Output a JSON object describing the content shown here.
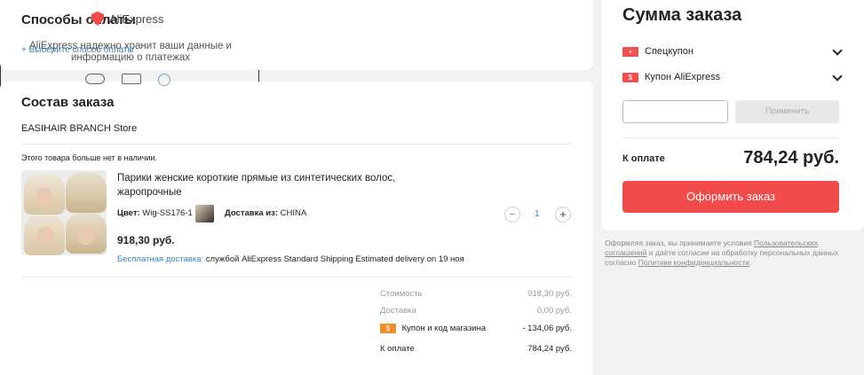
{
  "payment": {
    "title": "Способы оплаты",
    "choose_link": "+ Выберите способ оплаты"
  },
  "order": {
    "title": "Состав заказа",
    "store": "EASIHAIR BRANCH Store",
    "unavailable_notice": "Этого товара больше нет в наличии.",
    "item": {
      "name": "Парики женские короткие прямые из синтетических волос, жаропрочные",
      "color_label": "Цвет:",
      "color_value": "Wig-SS176-1",
      "delivery_from_label": "Доставка из:",
      "delivery_from_value": "CHINA",
      "quantity": "1",
      "price": "918,30 руб.",
      "shipping_label": "Бесплатная доставка:",
      "shipping_text": "службой AliExpress Standard Shipping  Estimated delivery on 19 ноя"
    },
    "summary": {
      "cost_label": "Стоимость",
      "cost_value": "918,30 руб.",
      "delivery_label": "Доставка",
      "delivery_value": "0,00 руб.",
      "coupon_icon": "$",
      "coupon_label": "Купон и код магазина",
      "coupon_value": "- 134,06 руб.",
      "total_label": "К оплате",
      "total_value": "784,24 руб."
    }
  },
  "sum": {
    "title": "Сумма заказа",
    "special_coupon_icon": "+",
    "special_coupon": "Спецкупон",
    "ae_coupon_icon": "$",
    "ae_coupon": "Купон AliExpress",
    "code_input_value": "",
    "apply_label": "Применить",
    "pay_label": "К оплате",
    "pay_total": "784,24 руб.",
    "checkout_label": "Оформить заказ"
  },
  "terms": {
    "text_1": "Оформляя заказ, вы принимаете условия ",
    "link_1": "Пользовательских соглашений",
    "text_2": " и даёте согласие на обработку персональных данных согласно ",
    "link_2": "Политике конфиденциальности",
    "text_3": "."
  },
  "secure": {
    "logo": "AliExpress",
    "text": "AliExpress надежно хранит ваши данные и информацию о платежах"
  },
  "colors": {
    "accent": "#f14b4b",
    "link": "#3d83c6",
    "coupon": "#f08c2a"
  }
}
